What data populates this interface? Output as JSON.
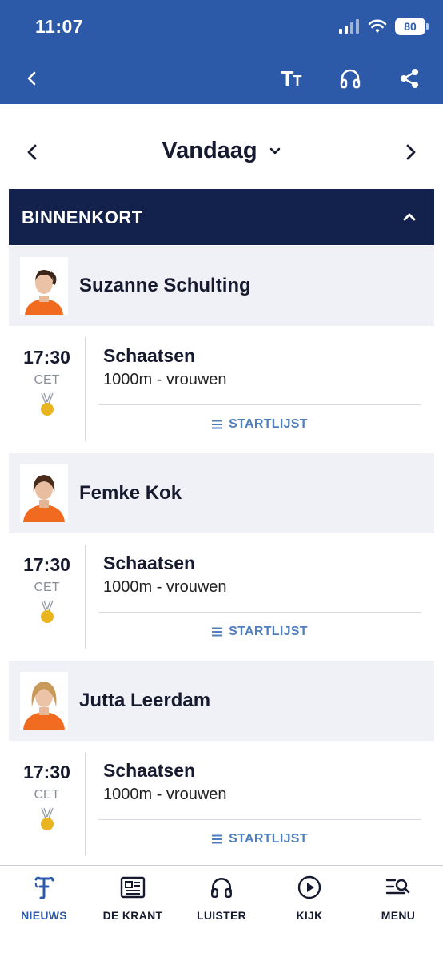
{
  "status_bar": {
    "time": "11:07",
    "battery": "80"
  },
  "date_nav": {
    "title": "Vandaag"
  },
  "section": {
    "title": "BINNENKORT"
  },
  "events": [
    {
      "athlete": "Suzanne Schulting",
      "time": "17:30",
      "timezone": "CET",
      "sport": "Schaatsen",
      "discipline": "1000m - vrouwen",
      "startlist_label": "STARTLIJST",
      "medal_color": "#e8b51f"
    },
    {
      "athlete": "Femke Kok",
      "time": "17:30",
      "timezone": "CET",
      "sport": "Schaatsen",
      "discipline": "1000m - vrouwen",
      "startlist_label": "STARTLIJST",
      "medal_color": "#e8b51f"
    },
    {
      "athlete": "Jutta Leerdam",
      "time": "17:30",
      "timezone": "CET",
      "sport": "Schaatsen",
      "discipline": "1000m - vrouwen",
      "startlist_label": "STARTLIJST",
      "medal_color": "#e8b51f"
    }
  ],
  "tabs": [
    {
      "label": "NIEUWS",
      "icon": "telegraaf-logo-icon",
      "active": true
    },
    {
      "label": "DE KRANT",
      "icon": "newspaper-icon",
      "active": false
    },
    {
      "label": "LUISTER",
      "icon": "headphones-icon",
      "active": false
    },
    {
      "label": "KIJK",
      "icon": "play-icon",
      "active": false
    },
    {
      "label": "MENU",
      "icon": "menu-search-icon",
      "active": false
    }
  ],
  "colors": {
    "header": "#2d5aa8",
    "section": "#13214d",
    "accent": "#4f7fbf",
    "athlete_row": "#f0f1f6"
  }
}
